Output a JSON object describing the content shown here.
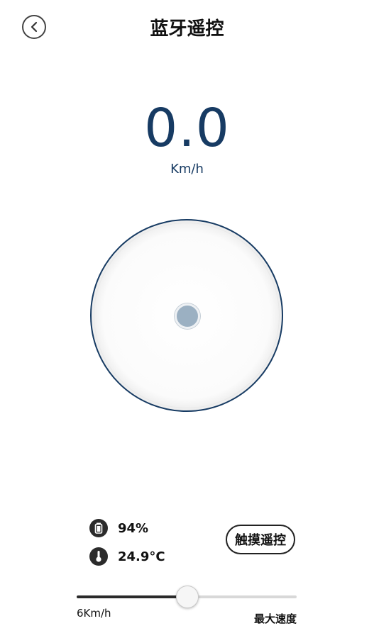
{
  "header": {
    "title": "蓝牙遥控",
    "back_icon": "chevron-left-icon"
  },
  "speed": {
    "value": "0.0",
    "unit": "Km/h"
  },
  "joystick": {
    "knob_position": [
      0,
      0
    ]
  },
  "status": {
    "battery": {
      "icon": "battery-icon",
      "text": "94%"
    },
    "temperature": {
      "icon": "thermometer-icon",
      "text": "24.9°C"
    }
  },
  "touch_control": {
    "label": "触摸遥控"
  },
  "speed_limit": {
    "min_label": "6Km/h",
    "max_label": "最大速度",
    "value_fraction": 0.5
  },
  "colors": {
    "accent": "#173b63",
    "knob": "#9bb0c2"
  }
}
